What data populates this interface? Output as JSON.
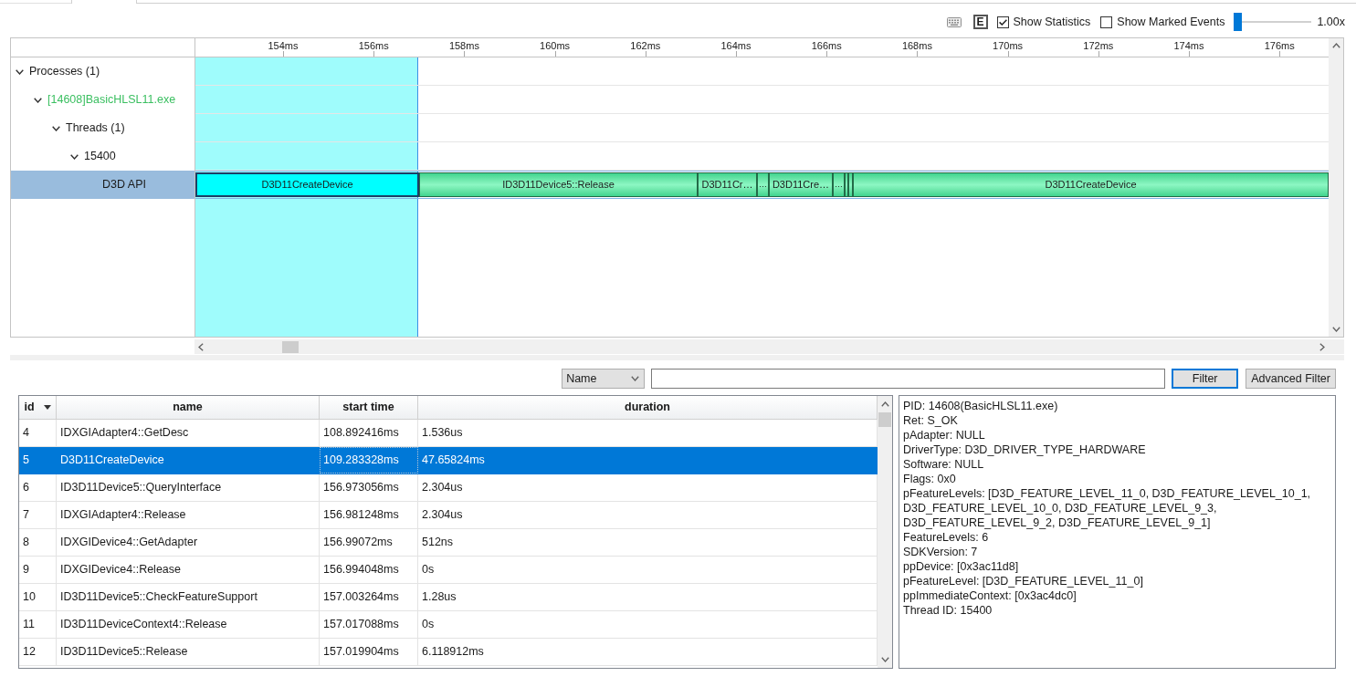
{
  "toolbar": {
    "event_button": {
      "label": "E"
    },
    "show_statistics": {
      "label": "Show Statistics",
      "checked": true
    },
    "show_marked_events": {
      "label": "Show Marked Events",
      "checked": false
    },
    "zoom": {
      "level": 0,
      "reading": "1.00x"
    }
  },
  "timeline": {
    "ticks": [
      "154ms",
      "156ms",
      "158ms",
      "160ms",
      "162ms",
      "164ms",
      "166ms",
      "168ms",
      "170ms",
      "172ms",
      "174ms",
      "176ms"
    ],
    "tree": [
      {
        "label": "Processes (1)",
        "color": "#1a1a1a",
        "expanded": true,
        "selected": false,
        "children": [
          {
            "label": "[14608]BasicHLSL11.exe",
            "color": "#3abf60",
            "expanded": true,
            "selected": false,
            "children": [
              {
                "label": "Threads (1)",
                "color": "#1a1a1a",
                "expanded": true,
                "selected": false,
                "children": [
                  {
                    "label": "15400",
                    "color": "#1a1a1a",
                    "expanded": true,
                    "selected": false,
                    "children": [
                      {
                        "label": "D3D API",
                        "color": "#1a1a1a",
                        "selected": true,
                        "events": [
                          {
                            "label": "D3D11CreateDevice",
                            "selected": true
                          },
                          {
                            "label": "ID3D11Device5::Release",
                            "selected": false
                          },
                          {
                            "label": "D3D11Cr…",
                            "selected": false
                          },
                          {
                            "label": "…",
                            "selected": false
                          },
                          {
                            "label": "D3D11Cre…",
                            "selected": false
                          },
                          {
                            "label": "…",
                            "selected": false
                          },
                          {
                            "selected": false
                          },
                          {
                            "selected": false
                          },
                          {
                            "label": "D3D11CreateDevice",
                            "selected": false
                          }
                        ]
                      }
                    ]
                  }
                ]
              }
            ]
          }
        ]
      }
    ]
  },
  "filter": {
    "field": "Name",
    "buttons": [
      {
        "label": "Filter",
        "focused": true
      },
      {
        "label": "Advanced Filter",
        "focused": false
      }
    ]
  },
  "table": {
    "columns": [
      {
        "label": "id",
        "sorted": true
      },
      {
        "label": "name",
        "sorted": false
      },
      {
        "label": "start time",
        "sorted": false
      },
      {
        "label": "duration",
        "sorted": false
      }
    ],
    "rows": [
      {
        "selected": false,
        "cells": [
          {
            "text": "4",
            "focused": false
          },
          {
            "text": "IDXGIAdapter4::GetDesc",
            "focused": false
          },
          {
            "text": "108.892416ms",
            "focused": false
          },
          {
            "text": "1.536us",
            "focused": false
          }
        ]
      },
      {
        "selected": true,
        "cells": [
          {
            "text": "5",
            "focused": false
          },
          {
            "text": "D3D11CreateDevice",
            "focused": false
          },
          {
            "text": "109.283328ms",
            "focused": true
          },
          {
            "text": "47.65824ms",
            "focused": false
          }
        ]
      },
      {
        "selected": false,
        "cells": [
          {
            "text": "6",
            "focused": false
          },
          {
            "text": "ID3D11Device5::QueryInterface",
            "focused": false
          },
          {
            "text": "156.973056ms",
            "focused": false
          },
          {
            "text": "2.304us",
            "focused": false
          }
        ]
      },
      {
        "selected": false,
        "cells": [
          {
            "text": "7",
            "focused": false
          },
          {
            "text": "IDXGIAdapter4::Release",
            "focused": false
          },
          {
            "text": "156.981248ms",
            "focused": false
          },
          {
            "text": "2.304us",
            "focused": false
          }
        ]
      },
      {
        "selected": false,
        "cells": [
          {
            "text": "8",
            "focused": false
          },
          {
            "text": "IDXGIDevice4::GetAdapter",
            "focused": false
          },
          {
            "text": "156.99072ms",
            "focused": false
          },
          {
            "text": "512ns",
            "focused": false
          }
        ]
      },
      {
        "selected": false,
        "cells": [
          {
            "text": "9",
            "focused": false
          },
          {
            "text": "IDXGIDevice4::Release",
            "focused": false
          },
          {
            "text": "156.994048ms",
            "focused": false
          },
          {
            "text": "0s",
            "focused": false
          }
        ]
      },
      {
        "selected": false,
        "cells": [
          {
            "text": "10",
            "focused": false
          },
          {
            "text": "ID3D11Device5::CheckFeatureSupport",
            "focused": false
          },
          {
            "text": "157.003264ms",
            "focused": false
          },
          {
            "text": "1.28us",
            "focused": false
          }
        ]
      },
      {
        "selected": false,
        "cells": [
          {
            "text": "11",
            "focused": false
          },
          {
            "text": "ID3D11DeviceContext4::Release",
            "focused": false
          },
          {
            "text": "157.017088ms",
            "focused": false
          },
          {
            "text": "0s",
            "focused": false
          }
        ]
      },
      {
        "selected": false,
        "cells": [
          {
            "text": "12",
            "focused": false
          },
          {
            "text": "ID3D11Device5::Release",
            "focused": false
          },
          {
            "text": "157.019904ms",
            "focused": false
          },
          {
            "text": "6.118912ms",
            "focused": false
          }
        ]
      }
    ]
  },
  "details": {
    "lines": [
      "PID: 14608(BasicHLSL11.exe)",
      "Ret: S_OK",
      "pAdapter: NULL",
      "DriverType: D3D_DRIVER_TYPE_HARDWARE",
      "Software: NULL",
      "Flags: 0x0",
      "pFeatureLevels: [D3D_FEATURE_LEVEL_11_0, D3D_FEATURE_LEVEL_10_1, D3D_FEATURE_LEVEL_10_0, D3D_FEATURE_LEVEL_9_3, D3D_FEATURE_LEVEL_9_2, D3D_FEATURE_LEVEL_9_1]",
      "FeatureLevels: 6",
      "SDKVersion: 7",
      "ppDevice: [0x3ac11d8]",
      "pFeatureLevel: [D3D_FEATURE_LEVEL_11_0]",
      "ppImmediateContext: [0x3ac4dc0]",
      "Thread ID: 15400"
    ]
  }
}
